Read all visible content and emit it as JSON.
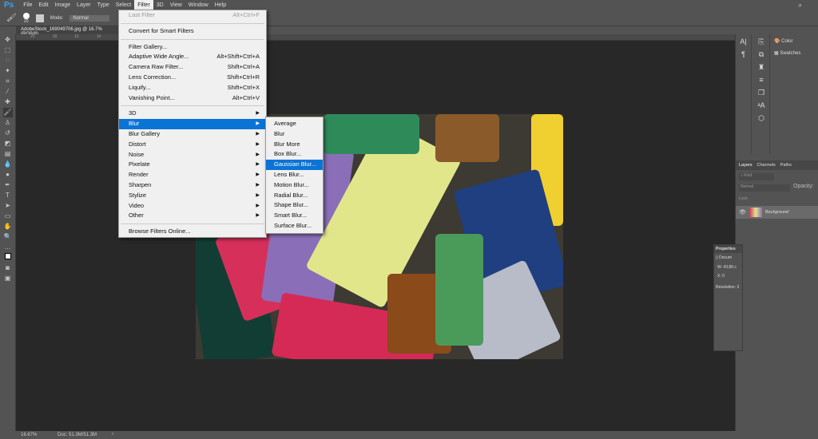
{
  "app": {
    "logo": "Ps"
  },
  "menubar": [
    "File",
    "Edit",
    "Image",
    "Layer",
    "Type",
    "Select",
    "Filter",
    "3D",
    "View",
    "Window",
    "Help"
  ],
  "options": {
    "brush_size": "20",
    "mode_label": "Mode:",
    "mode_value": "Normal"
  },
  "document": {
    "tab_title": "AdobeStock_169049706.jpg @ 16.7% (RGB/8)"
  },
  "ruler_ticks": [
    "20",
    "18",
    "16",
    "14",
    "12"
  ],
  "filter_menu": {
    "last_filter": {
      "label": "Last Filter",
      "shortcut": "Alt+Ctrl+F"
    },
    "convert": "Convert for Smart Filters",
    "group1": [
      {
        "label": "Filter Gallery...",
        "shortcut": ""
      },
      {
        "label": "Adaptive Wide Angle...",
        "shortcut": "Alt+Shift+Ctrl+A"
      },
      {
        "label": "Camera Raw Filter...",
        "shortcut": "Shift+Ctrl+A"
      },
      {
        "label": "Lens Correction...",
        "shortcut": "Shift+Ctrl+R"
      },
      {
        "label": "Liquify...",
        "shortcut": "Shift+Ctrl+X"
      },
      {
        "label": "Vanishing Point...",
        "shortcut": "Alt+Ctrl+V"
      }
    ],
    "group2": [
      "3D",
      "Blur",
      "Blur Gallery",
      "Distort",
      "Noise",
      "Pixelate",
      "Render",
      "Sharpen",
      "Stylize",
      "Video",
      "Other"
    ],
    "browse": "Browse Filters Online..."
  },
  "blur_submenu": [
    "Average",
    "Blur",
    "Blur More",
    "Box Blur...",
    "Gaussian Blur...",
    "Lens Blur...",
    "Motion Blur...",
    "Radial Blur...",
    "Shape Blur...",
    "Smart Blur...",
    "Surface Blur..."
  ],
  "right_panels": {
    "color": "Color",
    "swatches": "Swatches"
  },
  "layers_panel": {
    "tabs": [
      "Layers",
      "Channels",
      "Paths"
    ],
    "kind_placeholder": "Kind",
    "blend": "Normal",
    "opacity": "Opacity:",
    "lock": "Lock:",
    "layer_name": "Background"
  },
  "properties": {
    "title": "Properties",
    "doc": "Docum",
    "w": "W:",
    "w_val": "43.89 c",
    "x": "X:",
    "x_val": "0",
    "resolution": "Resolution: 3"
  },
  "status": {
    "zoom": "16.67%",
    "doc": "Doc: 51.3M/51.3M",
    "arrow": "›"
  }
}
